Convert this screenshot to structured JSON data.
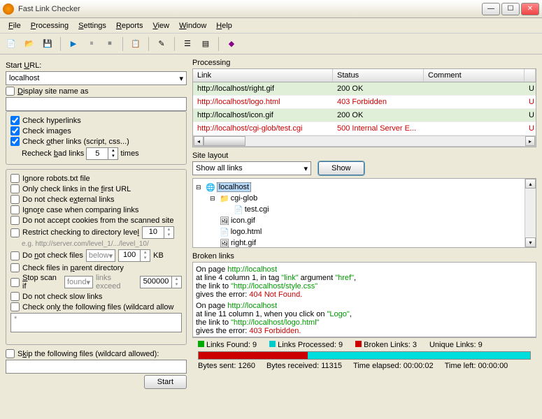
{
  "window": {
    "title": "Fast Link Checker"
  },
  "menu": {
    "file": "File",
    "processing": "Processing",
    "settings": "Settings",
    "reports": "Reports",
    "view": "View",
    "window": "Window",
    "help": "Help"
  },
  "left": {
    "start_url_label": "Start URL:",
    "start_url_value": "localhost",
    "display_as_label": "Display site name as",
    "display_as_value": "",
    "chk_hyperlinks": "Check hyperlinks",
    "chk_images": "Check images",
    "chk_other": "Check other links (script, css...)",
    "recheck_label": "Recheck bad links",
    "recheck_value": "5",
    "recheck_times": "times",
    "ignore_robots": "Ignore robots.txt file",
    "only_first": "Only check links in the first URL",
    "no_external": "Do not check external links",
    "ignore_case": "Ignore case when comparing links",
    "no_cookies": "Do not accept cookies from the scanned site",
    "restrict_dir": "Restrict checking to directory level",
    "restrict_dir_val": "10",
    "restrict_hint": "e.g. http://server.com/level_1/.../level_10/",
    "no_files": "Do not check files",
    "no_files_sel": "below",
    "no_files_val": "100",
    "no_files_kb": "KB",
    "parent_dir": "Check files in parent directory",
    "stop_scan": "Stop scan if",
    "stop_sel": "found",
    "stop_lbl": "links exceed",
    "stop_val": "500000",
    "no_slow": "Do not check slow links",
    "only_following": "Check only the following files (wildcard allow",
    "only_val": "*",
    "skip_following": "Skip the following files (wildcard allowed):",
    "skip_val": "",
    "start_btn": "Start"
  },
  "processing": {
    "title": "Processing",
    "cols": {
      "link": "Link",
      "status": "Status",
      "comment": "Comment"
    },
    "rows": [
      {
        "link": "http://localhost/right.gif",
        "status": "200 OK",
        "cls": "ok"
      },
      {
        "link": "http://localhost/logo.html",
        "status": "403 Forbidden",
        "cls": "err"
      },
      {
        "link": "http://localhost/icon.gif",
        "status": "200 OK",
        "cls": "ok"
      },
      {
        "link": "http://localhost/cgi-glob/test.cgi",
        "status": "500 Internal Server E...",
        "cls": "err"
      }
    ]
  },
  "sitelayout": {
    "title": "Site layout",
    "filter": "Show all links",
    "show_btn": "Show",
    "tree": [
      {
        "ind": 0,
        "exp": "⊟",
        "icon": "🌐",
        "name": "localhost",
        "sel": true
      },
      {
        "ind": 20,
        "exp": "⊟",
        "icon": "📁",
        "name": "cgi-glob"
      },
      {
        "ind": 40,
        "exp": "",
        "icon": "📄",
        "name": "test.cgi"
      },
      {
        "ind": 20,
        "exp": "",
        "icon": "🖼",
        "name": "icon.gif"
      },
      {
        "ind": 20,
        "exp": "",
        "icon": "📄",
        "name": "logo.html"
      },
      {
        "ind": 20,
        "exp": "",
        "icon": "🖼",
        "name": "right.gif"
      }
    ]
  },
  "broken": {
    "title": "Broken links",
    "p1_on": "On page ",
    "p1_url": "http://localhost",
    "p1_l2a": "at line 4 column 1, in tag ",
    "p1_tag": "\"link\"",
    "p1_l2b": " argument ",
    "p1_arg": "\"href\"",
    "p1_l2c": ",",
    "p1_l3a": "the link to ",
    "p1_link": "\"http://localhost/style.css\"",
    "p1_l4a": "gives the error: ",
    "p1_err": "404 Not Found.",
    "p2_on": "On page ",
    "p2_url": "http://localhost",
    "p2_l2a": "at line 11 column 1, when you click on ",
    "p2_click": "\"Logo\"",
    "p2_l2b": ",",
    "p2_l3a": "the link to ",
    "p2_link": "\"http://localhost/logo.html\"",
    "p2_l4a": "gives the error: ",
    "p2_err": "403 Forbidden."
  },
  "status": {
    "found_lbl": "Links Found: ",
    "found": "9",
    "proc_lbl": "Links Processed: ",
    "proc": "9",
    "broken_lbl": "Broken Links: ",
    "broken": "3",
    "unique_lbl": "Unique Links: ",
    "unique": "9",
    "sent_lbl": "Bytes sent: ",
    "sent": "1260",
    "recv_lbl": "Bytes received: ",
    "recv": "11315",
    "elapsed_lbl": "Time elapsed: ",
    "elapsed": "00:00:02",
    "left_lbl": "Time left: ",
    "left": "00:00:00",
    "colors": {
      "found": "#0a0",
      "proc": "#0cc",
      "broken": "#c00"
    }
  }
}
